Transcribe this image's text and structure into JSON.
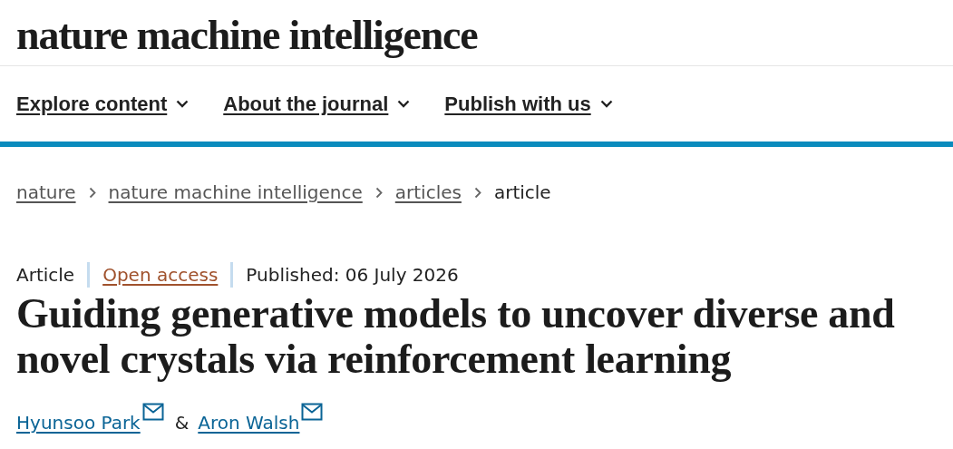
{
  "site_logo": "nature machine intelligence",
  "nav": [
    {
      "label": "Explore content"
    },
    {
      "label": "About the journal"
    },
    {
      "label": "Publish with us"
    }
  ],
  "breadcrumbs": [
    {
      "label": "nature",
      "kind": "link"
    },
    {
      "label": "nature machine intelligence",
      "kind": "link"
    },
    {
      "label": "articles",
      "kind": "link"
    },
    {
      "label": "article",
      "kind": "current"
    }
  ],
  "meta": [
    {
      "text": "Article",
      "kind": "type"
    },
    {
      "text": "Open access",
      "kind": "access"
    },
    {
      "text": "Published: 06 July 2026",
      "kind": "date"
    }
  ],
  "title": "Guiding generative models to uncover diverse and novel crystals via reinforcement learning",
  "authors": [
    {
      "name": "Hyunsoo Park",
      "email": true
    },
    {
      "name": "Aron Walsh",
      "email": true
    }
  ],
  "author_separator": "&"
}
